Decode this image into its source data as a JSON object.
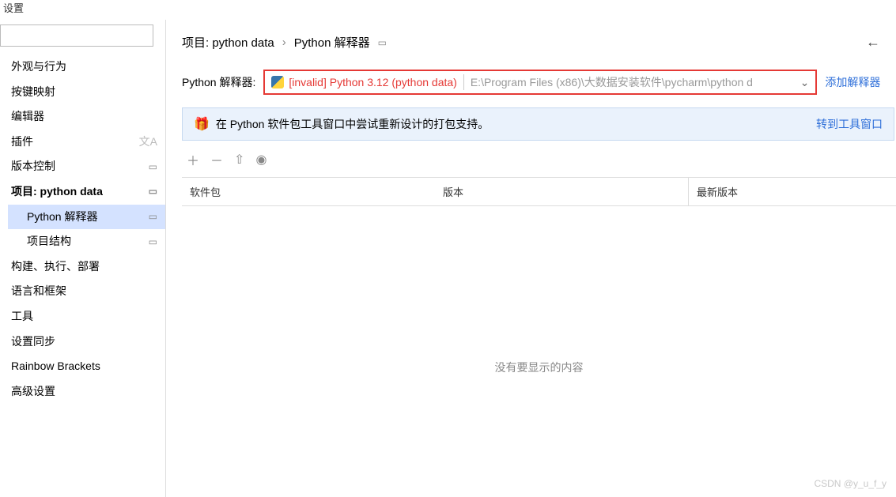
{
  "window": {
    "title": "设置"
  },
  "sidebar": {
    "search_placeholder": "",
    "items": [
      {
        "label": "外观与行为",
        "icon": ""
      },
      {
        "label": "按键映射",
        "icon": ""
      },
      {
        "label": "编辑器",
        "icon": ""
      },
      {
        "label": "插件",
        "icon": "lang"
      },
      {
        "label": "版本控制",
        "icon": "cfg"
      },
      {
        "label": "项目: python data",
        "icon": "cfg",
        "bold": true
      },
      {
        "label": "Python 解释器",
        "icon": "cfg",
        "child": true,
        "selected": true
      },
      {
        "label": "项目结构",
        "icon": "cfg",
        "child": true
      },
      {
        "label": "构建、执行、部署",
        "icon": ""
      },
      {
        "label": "语言和框架",
        "icon": ""
      },
      {
        "label": "工具",
        "icon": ""
      },
      {
        "label": "设置同步",
        "icon": ""
      },
      {
        "label": "Rainbow Brackets",
        "icon": ""
      },
      {
        "label": "高级设置",
        "icon": ""
      }
    ]
  },
  "breadcrumb": {
    "project": "项目: python data",
    "page": "Python 解释器"
  },
  "interpreter": {
    "label": "Python 解释器:",
    "selected": "[invalid] Python 3.12 (python data)",
    "path": "E:\\Program Files (x86)\\大数据安装软件\\pycharm\\python d",
    "add_label": "添加解释器"
  },
  "banner": {
    "text": "在 Python 软件包工具窗口中尝试重新设计的打包支持。",
    "link": "转到工具窗口"
  },
  "table": {
    "columns": [
      "软件包",
      "版本",
      "最新版本"
    ],
    "empty": "没有要显示的内容"
  },
  "watermark": "CSDN @y_u_f_y"
}
